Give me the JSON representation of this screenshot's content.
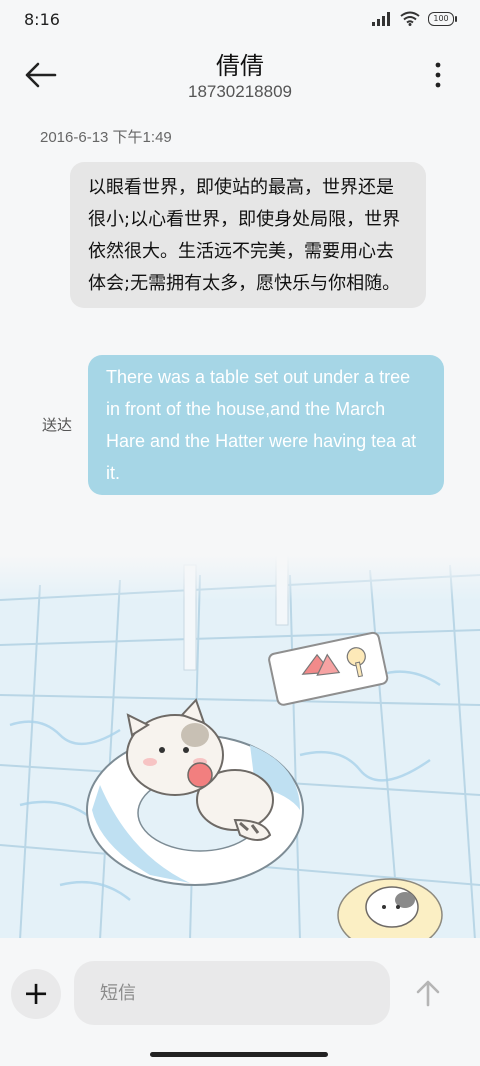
{
  "status_bar": {
    "time": "8:16",
    "battery_level": "100"
  },
  "header": {
    "contact_name": "倩倩",
    "phone_number": "18730218809"
  },
  "messages": {
    "timestamp": "2016-6-13 下午1:49",
    "received": "以眼看世界，即使站的最高，世界还是很小;以心看世界，即使身处局限，世界依然很大。生活远不完美，需要用心去体会;无需拥有太多，愿快乐与你相随。",
    "sent": "There was a table set out under a tree in front of the house,and the March Hare and the Hatter were having tea at it.",
    "sent_status": "送达"
  },
  "composer": {
    "placeholder": "短信"
  },
  "icons": {
    "back": "back-arrow-icon",
    "more": "more-vertical-icon",
    "add": "plus-icon",
    "send": "send-arrow-up-icon"
  },
  "colors": {
    "bubble_in": "#e6e6e6",
    "bubble_out": "#a6d6e6",
    "background": "#f6f7f8"
  }
}
